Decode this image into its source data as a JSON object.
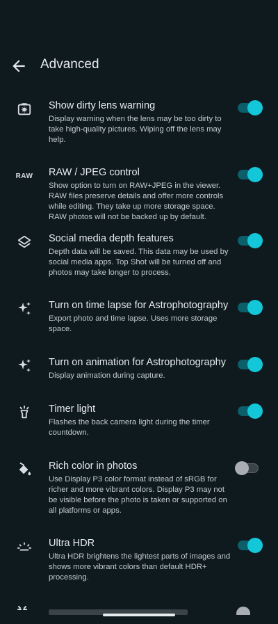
{
  "header": {
    "title": "Advanced"
  },
  "settings": [
    {
      "icon": "lens-icon",
      "title": "Show dirty lens warning",
      "description": "Display warning when the lens may be too dirty to take high-quality pictures. Wiping off the lens may help.",
      "enabled": true
    },
    {
      "icon": "raw-icon",
      "icon_text": "RAW",
      "title": "RAW / JPEG control",
      "description": "Show option to turn on RAW+JPEG in the viewer. RAW files preserve details and offer more controls while editing. They take up more storage space. RAW photos will not be backed up by default.",
      "enabled": true
    },
    {
      "icon": "layers-icon",
      "title": "Social media depth features",
      "description": "Depth data will be saved. This data may be used by social media apps. Top Shot will be turned off and photos may take longer to process.",
      "enabled": true
    },
    {
      "icon": "sparkle-icon",
      "title": "Turn on time lapse for Astrophotography",
      "description": "Export photo and time lapse. Uses more storage space.",
      "enabled": true
    },
    {
      "icon": "sparkle-icon",
      "title": "Turn on animation for Astrophotography",
      "description": "Display animation during capture.",
      "enabled": true
    },
    {
      "icon": "light-icon",
      "title": "Timer light",
      "description": "Flashes the back camera light during the timer countdown.",
      "enabled": true
    },
    {
      "icon": "paint-bucket-icon",
      "title": "Rich color in photos",
      "description": "Use Display P3 color format instead of sRGB for richer and more vibrant colors. Display P3 may not be visible before the photo is taken or supported on all platforms or apps.",
      "enabled": false
    },
    {
      "icon": "hdr-icon",
      "title": "Ultra HDR",
      "description": "Ultra HDR brightens the lightest parts of images and shows more vibrant colors than default HDR+ processing.",
      "enabled": true
    }
  ],
  "colors": {
    "background": "#0f1a1f",
    "accent": "#13c7d8",
    "track_on": "#0a5f6a"
  }
}
